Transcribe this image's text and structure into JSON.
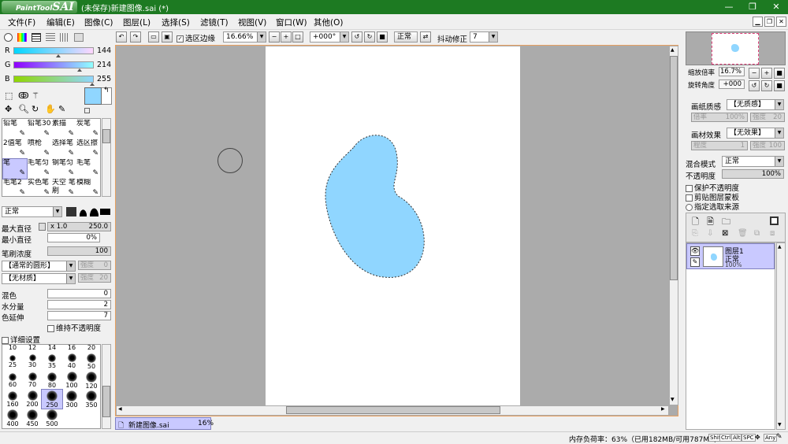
{
  "app": {
    "logo_small": "PaintTool",
    "logo_big": "SAI",
    "window_title": "(未保存)新建图像.sai (*)",
    "win_minimize": "—",
    "win_restore": "❐",
    "win_close": "✕"
  },
  "menu": [
    "文件(F)",
    "编辑(E)",
    "图像(C)",
    "图层(L)",
    "选择(S)",
    "滤镜(T)",
    "视图(V)",
    "窗口(W)",
    "其他(O)"
  ],
  "toolbar": {
    "selection_edge_label": "选区边缘",
    "zoom": "16.66%",
    "rotation": "+000°",
    "mode": "正常",
    "stabilizer_label": "抖动修正",
    "stabilizer_value": "7"
  },
  "color": {
    "r_label": "R",
    "r_value": "144",
    "g_label": "G",
    "g_value": "214",
    "b_label": "B",
    "b_value": "255",
    "foreground": "#90d6ff",
    "background": "#ffffff",
    "r_fraction": 0.565,
    "g_fraction": 0.839,
    "b_fraction": 1.0
  },
  "tools": [
    "铅笔",
    "铅笔30",
    "素描",
    "炭笔",
    "2值笔",
    "喷枪",
    "选择笔",
    "选区擦",
    "笔",
    "毛笔匀",
    "钢笔匀",
    "毛笔",
    "毛笔2",
    "实色笔",
    "天空 笔刷",
    "模糊"
  ],
  "brush": {
    "blend_mode": "正常",
    "max_diameter_label": "最大直径",
    "max_diameter_mult": "x 1.0",
    "max_diameter_value": "250.0",
    "min_diameter_label": "最小直径",
    "min_diameter_value": "0%",
    "density_label": "笔刷浓度",
    "density_value": "100",
    "shape_label": "【通常的圆形】",
    "shape_strength_label": "强度",
    "shape_strength_value": "0",
    "texture_label": "【无材质】",
    "texture_strength_label": "强度",
    "texture_strength_value": "20",
    "blend_label": "混色",
    "blend_value": "0",
    "water_label": "水分量",
    "water_value": "2",
    "color_stretch_label": "色延伸",
    "color_stretch_value": "7",
    "keep_opacity_label": "维持不透明度",
    "detail_label": "详细设置"
  },
  "brush_sizes": [
    [
      "10",
      "12",
      "14",
      "16",
      "20"
    ],
    [
      "25",
      "30",
      "35",
      "40",
      "50"
    ],
    [
      "60",
      "70",
      "80",
      "100",
      "120"
    ],
    [
      "160",
      "200",
      "250",
      "300",
      "350"
    ],
    [
      "400",
      "450",
      "500"
    ]
  ],
  "selected_brush_size": "250",
  "navigator": {
    "zoom_label": "缩放倍率",
    "zoom_value": "16.7%",
    "angle_label": "旋转角度",
    "angle_value": "+000"
  },
  "paper": {
    "texture_label": "画纸质感",
    "texture_value": "【无质感】",
    "scale_label": "倍率",
    "scale_value": "100%",
    "strength_label": "强度",
    "strength_value": "20",
    "effect_label": "画材效果",
    "effect_value": "【无效果】",
    "degree_label": "程度",
    "degree_value": "1",
    "strength2_label": "强度",
    "strength2_value": "100"
  },
  "layer_props": {
    "blend_label": "混合模式",
    "blend_value": "正常",
    "opacity_label": "不透明度",
    "opacity_value": "100%",
    "protect_label": "保护不透明度",
    "clip_label": "剪贴图层蒙板",
    "source_label": "指定选取来源"
  },
  "layers": [
    {
      "name": "图层1",
      "mode": "正常",
      "opacity": "100%"
    }
  ],
  "doc_tab": {
    "name": "新建图像.sai",
    "zoom": "16%"
  },
  "status": {
    "memory": "内存负荷率：63%（已用182MB/可用787MB）",
    "keys": [
      "Shift",
      "Ctrl",
      "Alt",
      "SPC",
      "Any"
    ]
  },
  "colors": {
    "titlebar": "#1d7a22",
    "selection_fill": "#90d6ff",
    "canvas_bg": "#ababab",
    "accent_frame": "#e8a060"
  }
}
